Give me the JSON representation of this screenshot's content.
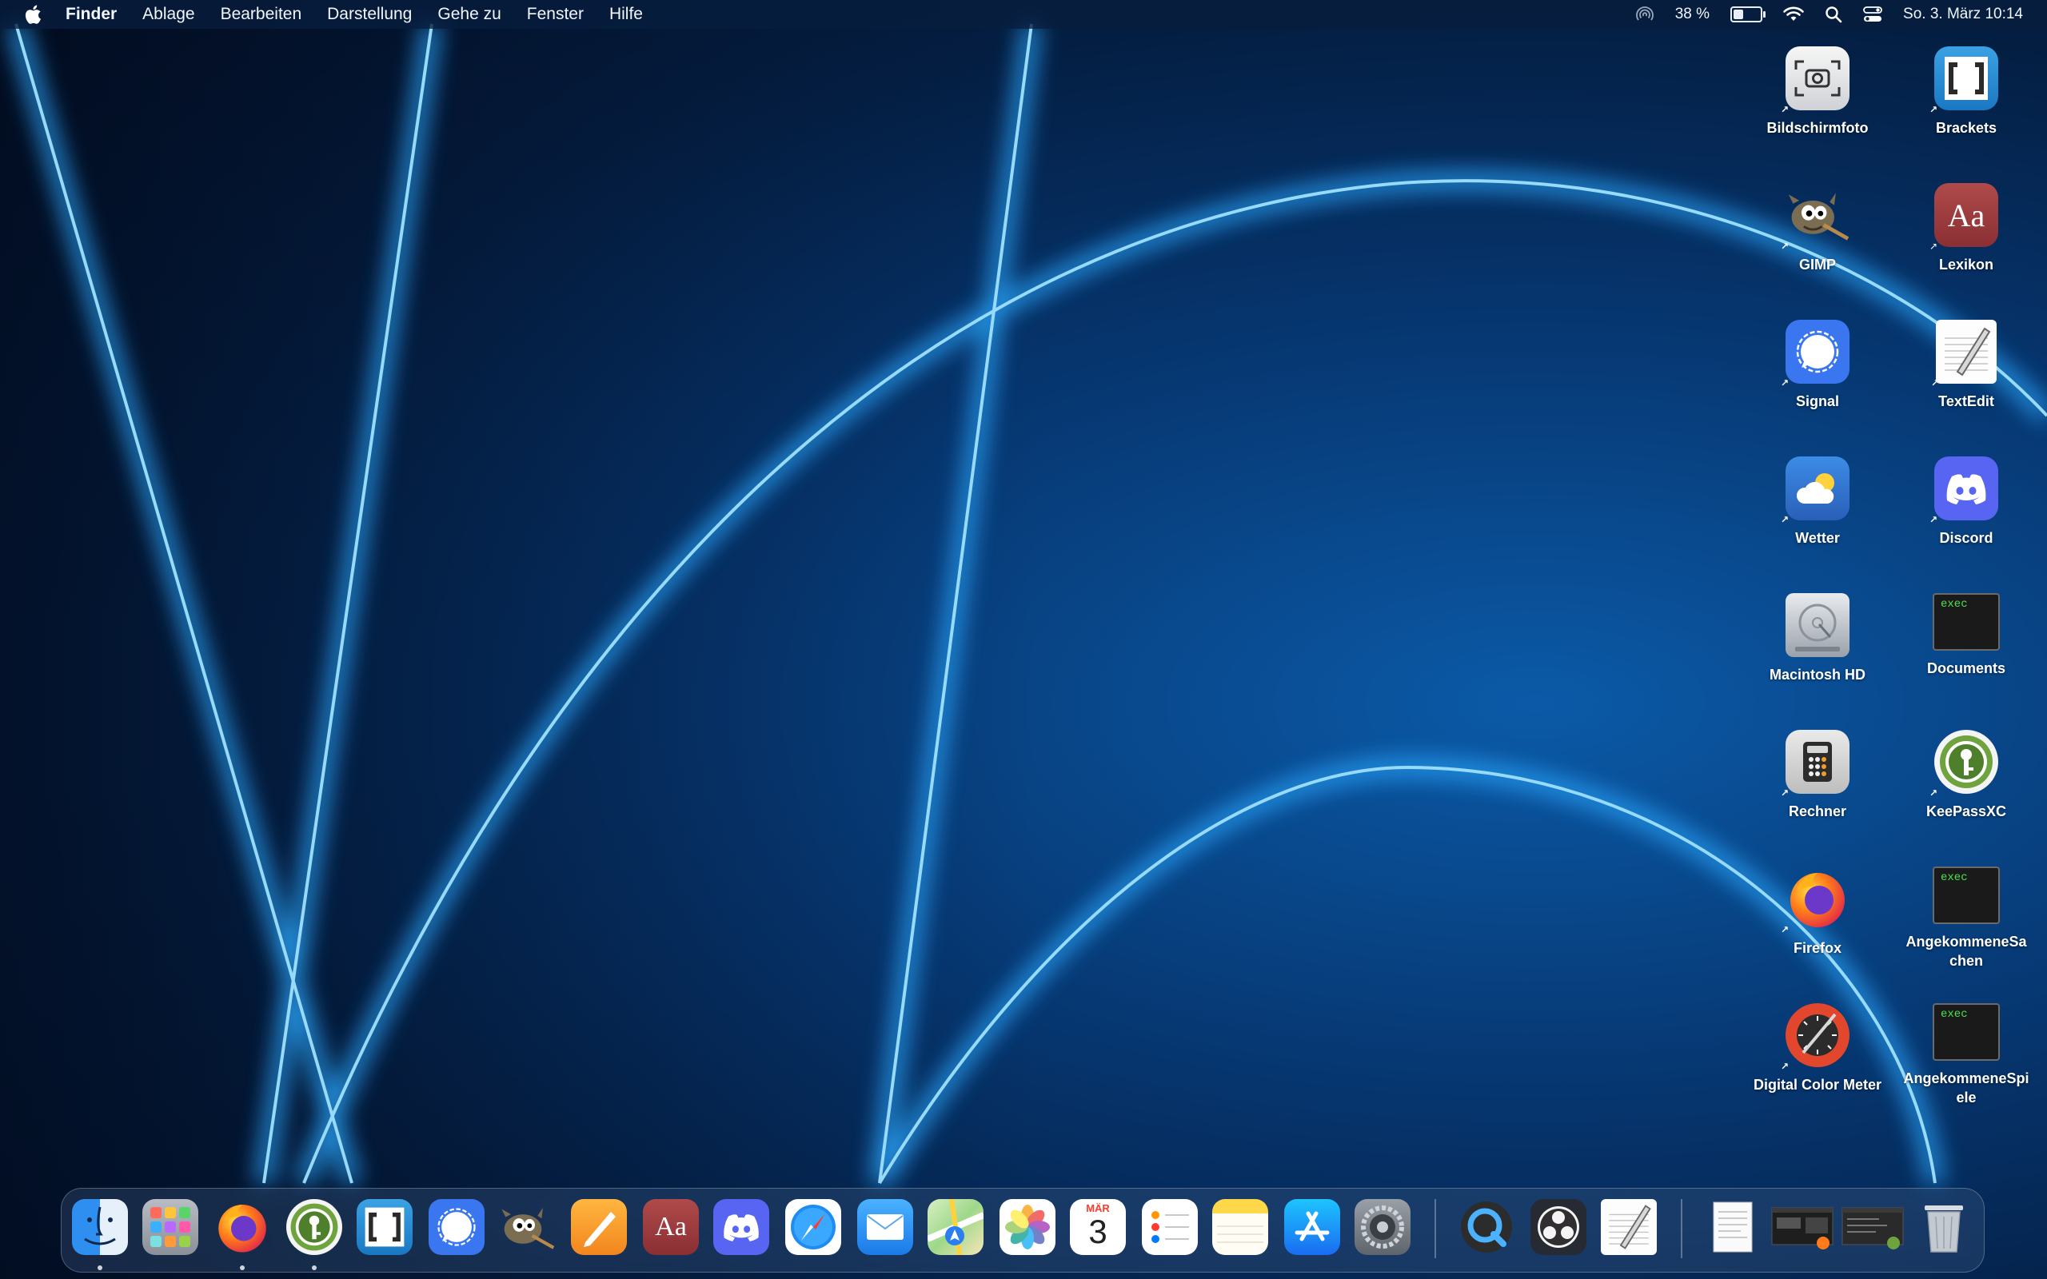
{
  "menubar": {
    "app_name": "Finder",
    "menus": [
      "Ablage",
      "Bearbeiten",
      "Darstellung",
      "Gehe zu",
      "Fenster",
      "Hilfe"
    ],
    "battery_text": "38 %",
    "battery_level": 0.38,
    "datetime": "So. 3. März 10:14",
    "status_icons": [
      "airdrop-icon",
      "battery-icon",
      "wifi-icon",
      "search-icon",
      "control-center-icon"
    ]
  },
  "desktop": {
    "icons": [
      {
        "label": "Bildschirmfoto",
        "icon": "screenshot-icon"
      },
      {
        "label": "Brackets",
        "icon": "brackets-icon"
      },
      {
        "label": "GIMP",
        "icon": "gimp-icon"
      },
      {
        "label": "Lexikon",
        "icon": "dictionary-icon"
      },
      {
        "label": "Signal",
        "icon": "signal-icon"
      },
      {
        "label": "TextEdit",
        "icon": "textedit-icon"
      },
      {
        "label": "Wetter",
        "icon": "weather-icon"
      },
      {
        "label": "Discord",
        "icon": "discord-icon"
      },
      {
        "label": "Macintosh HD",
        "icon": "harddisk-icon"
      },
      {
        "label": "Documents",
        "icon": "exec-file-icon"
      },
      {
        "label": "Rechner",
        "icon": "calculator-icon"
      },
      {
        "label": "KeePassXC",
        "icon": "keepassxc-icon"
      },
      {
        "label": "Firefox",
        "icon": "firefox-icon"
      },
      {
        "label": "AngekommeneSachen",
        "icon": "exec-file-icon"
      },
      {
        "label": "Digital Color Meter",
        "icon": "color-meter-icon"
      },
      {
        "label": "AngekommeneSpiele",
        "icon": "exec-file-icon"
      }
    ],
    "exec_text": "exec",
    "dictionary_glyph": "Aa"
  },
  "dock": {
    "calendar_month": "MÄR",
    "calendar_day": "3",
    "items": [
      "finder-icon",
      "launchpad-icon",
      "firefox-icon",
      "keepassxc-icon",
      "brackets-icon",
      "signal-icon",
      "gimp-icon",
      "pages-icon",
      "dictionary-icon",
      "discord-icon",
      "safari-icon",
      "mail-icon",
      "maps-icon",
      "photos-icon",
      "calendar-icon",
      "reminders-icon",
      "notes-icon",
      "app-store-icon",
      "system-settings-icon",
      "quicktime-icon",
      "obs-icon",
      "textedit-icon",
      "document-icon",
      "window-thumbnail-icon",
      "window-thumbnail-icon",
      "trash-icon"
    ]
  },
  "colors": {
    "accent_blue": "#1aa0ff",
    "menubar_bg": "#081e3e"
  }
}
